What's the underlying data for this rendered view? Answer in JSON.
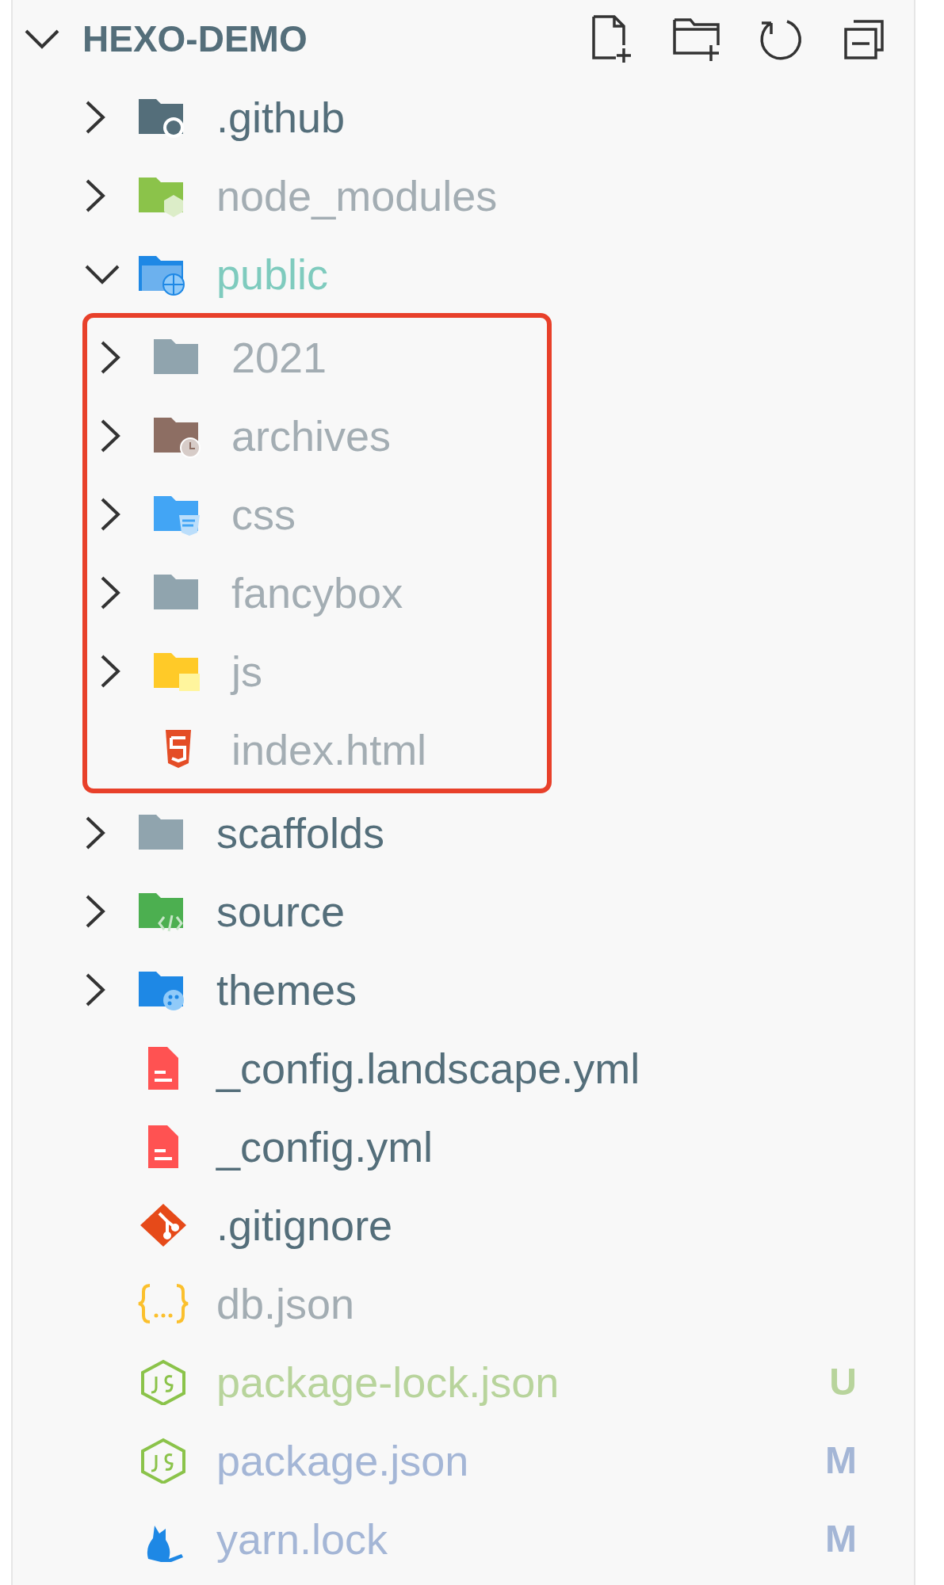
{
  "explorer": {
    "title": "HEXO-DEMO",
    "expanded": true,
    "items": [
      {
        "name": ".github",
        "kind": "github",
        "color": "#546e7a",
        "expanded": false
      },
      {
        "name": "node_modules",
        "kind": "node",
        "color": "#a3adb3",
        "expanded": false
      },
      {
        "name": "public",
        "kind": "web",
        "color": "#7fcbbe",
        "expanded": true,
        "highlight_children": true,
        "children": [
          {
            "name": "2021",
            "kind": "plain",
            "color": "#a3adb3",
            "expanded": false
          },
          {
            "name": "archives",
            "kind": "archive",
            "color": "#a3adb3",
            "expanded": false
          },
          {
            "name": "css",
            "kind": "css",
            "color": "#a3adb3",
            "expanded": false
          },
          {
            "name": "fancybox",
            "kind": "plain",
            "color": "#a3adb3",
            "expanded": false
          },
          {
            "name": "js",
            "kind": "js",
            "color": "#a3adb3",
            "expanded": false
          },
          {
            "name": "index.html",
            "kind": "html",
            "color": "#a3adb3"
          }
        ]
      },
      {
        "name": "scaffolds",
        "kind": "plain",
        "color": "#546e7a",
        "expanded": false
      },
      {
        "name": "source",
        "kind": "code",
        "color": "#546e7a",
        "expanded": false
      },
      {
        "name": "themes",
        "kind": "theme",
        "color": "#546e7a",
        "expanded": false
      },
      {
        "name": "_config.landscape.yml",
        "kind": "yaml",
        "color": "#546e7a"
      },
      {
        "name": "_config.yml",
        "kind": "yaml",
        "color": "#546e7a"
      },
      {
        "name": ".gitignore",
        "kind": "git",
        "color": "#546e7a"
      },
      {
        "name": "db.json",
        "kind": "json",
        "color": "#a3adb3"
      },
      {
        "name": "package-lock.json",
        "kind": "npm",
        "color": "#b8d49c",
        "badge": "U"
      },
      {
        "name": "package.json",
        "kind": "npm",
        "color": "#a4b6d6",
        "badge": "M"
      },
      {
        "name": "yarn.lock",
        "kind": "yarn",
        "color": "#a4b6d6",
        "badge": "M"
      }
    ]
  }
}
